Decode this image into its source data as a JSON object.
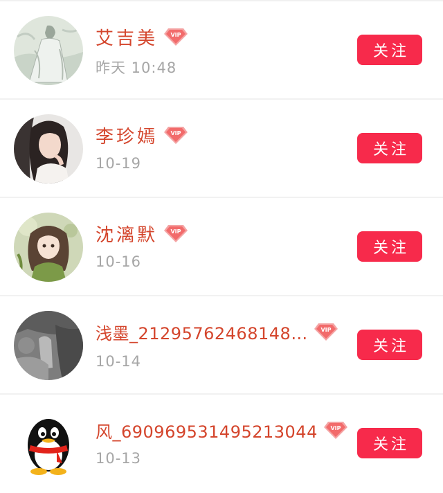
{
  "follow_label": "关注",
  "vip_badge_text": "VIP",
  "colors": {
    "name": "#d4452c",
    "time": "#a6a6a6",
    "button_bg": "#f72a4b",
    "button_text": "#ffffff",
    "vip_badge": "#f26b6b"
  },
  "users": [
    {
      "name": "艾吉美",
      "time": "昨天 10:48",
      "avatar": "ink-painting-figure"
    },
    {
      "name": "李珍嫣",
      "time": "10-19",
      "avatar": "girl-photo"
    },
    {
      "name": "沈漓默",
      "time": "10-16",
      "avatar": "anime-girl"
    },
    {
      "name": "浅墨_21295762468148…",
      "time": "10-14",
      "avatar": "blurry-photo"
    },
    {
      "name": "风_690969531495213044",
      "time": "10-13",
      "avatar": "qq-penguin"
    }
  ]
}
